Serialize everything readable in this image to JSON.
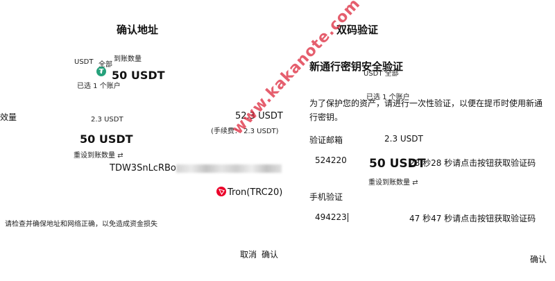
{
  "left": {
    "title": "确认地址",
    "asset_label": "USDT",
    "all_label": "全部",
    "amount_label": "到账数量",
    "coin_icon": "usdt-icon",
    "amount_big": "50 USDT",
    "selected_account": "已选 1 个账户",
    "qty_cut_label": "效量",
    "fee_small": "2.3 USDT",
    "total_amount": "52.3 USDT",
    "fee_note": "(手续费： 2.3 USDT)",
    "receive_amount": "50 USDT",
    "reset_label": "重设到账数量",
    "address_prefix": "TDW3SnLcRBo",
    "network": "Tron(TRC20)",
    "warning": "请检查并确保地址和网络正确，以免造成资金损失",
    "cancel": "取消",
    "confirm": "确认"
  },
  "right": {
    "title": "双码验证",
    "heading": "新通行密钥安全验证",
    "ghost_asset": "USDT 全部",
    "ghost_selected": "已选 1 个账户",
    "description": "为了保护您的资产，请进行一次性验证，以便在提币时使用新通行密钥。",
    "email_label": "验证邮箱",
    "ghost_fee": "2.3 USDT",
    "email_code": "524220",
    "ghost_amount": "50 USDT",
    "email_countdown": "28 秒28 秒请点击按钮获取验证码",
    "ghost_reset": "重设到账数量",
    "phone_label": "手机验证",
    "phone_code": "494223",
    "phone_countdown": "47 秒47 秒请点击按钮获取验证码",
    "confirm": "确认"
  },
  "watermark": "www.kakanote.com",
  "colors": {
    "usdt": "#26a17b",
    "tron": "#eb0029",
    "watermark": "#dc283c"
  }
}
